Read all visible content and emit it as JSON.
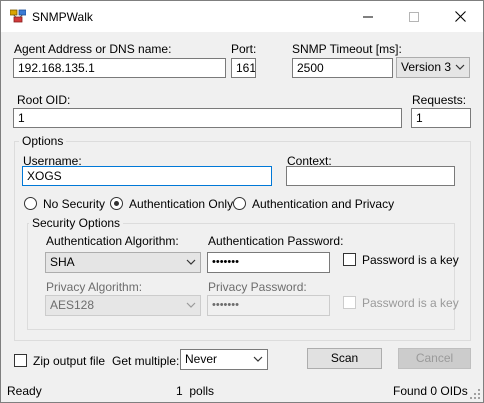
{
  "window": {
    "title": "SNMPWalk"
  },
  "fields": {
    "agent_label": "Agent Address or DNS name:",
    "agent_value": "192.168.135.1",
    "port_label": "Port:",
    "port_value": "161",
    "timeout_label": "SNMP Timeout [ms]:",
    "timeout_value": "2500",
    "version_value": "Version 3",
    "root_oid_label": "Root OID:",
    "root_oid_value": "1",
    "requests_label": "Requests:",
    "requests_value": "1"
  },
  "options": {
    "group_title": "Options",
    "username_label": "Username:",
    "username_value": "XOGS",
    "context_label": "Context:",
    "context_value": "",
    "radios": [
      {
        "label": "No Security",
        "selected": false
      },
      {
        "label": "Authentication Only",
        "selected": true
      },
      {
        "label": "Authentication and Privacy",
        "selected": false
      }
    ],
    "security": {
      "group_title": "Security Options",
      "auth_algo_label": "Authentication Algorithm:",
      "auth_algo_value": "SHA",
      "auth_pw_label": "Authentication Password:",
      "auth_pw_value": "•••••••",
      "auth_key_label": "Password is a key",
      "priv_algo_label": "Privacy Algorithm:",
      "priv_algo_value": "AES128",
      "priv_pw_label": "Privacy Password:",
      "priv_pw_value": "•••••••",
      "priv_key_label": "Password is a key"
    }
  },
  "bottom": {
    "zip_label": "Zip output file",
    "get_multiple_label": "Get multiple:",
    "get_multiple_value": "Never",
    "scan_label": "Scan",
    "cancel_label": "Cancel"
  },
  "status": {
    "state": "Ready",
    "polls": "1  polls",
    "found": "Found 0 OIDs"
  }
}
